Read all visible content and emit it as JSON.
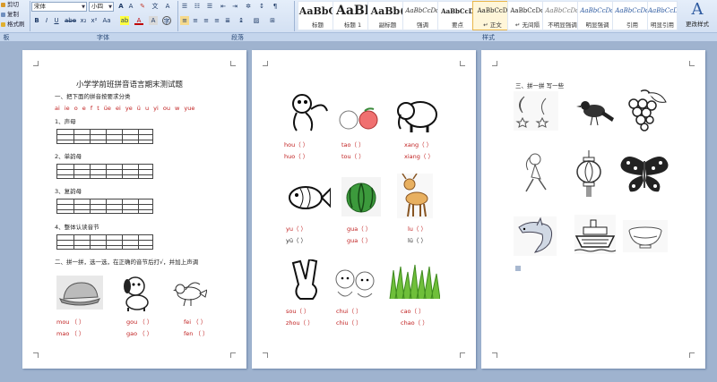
{
  "ribbon": {
    "clipboard": {
      "cut": "剪切",
      "copy": "复制",
      "format_painter": "格式刷"
    },
    "font_name": "宋体",
    "font_size": "小四",
    "groups": {
      "clipboard": "板",
      "font": "字体",
      "paragraph": "段落",
      "styles": "样式"
    },
    "styles": [
      {
        "sample": "AaBbC",
        "name": "标题"
      },
      {
        "sample": "AaBl",
        "name": "标题 1"
      },
      {
        "sample": "AaBb(",
        "name": "副标题"
      },
      {
        "sample": "AaBbCcDd",
        "name": "强调"
      },
      {
        "sample": "AaBbCcD",
        "name": "要点"
      },
      {
        "sample": "AaBbCcD",
        "name": "↵ 正文"
      },
      {
        "sample": "AaBbCcDd",
        "name": "↵ 无间隔"
      },
      {
        "sample": "AaBbCcDd",
        "name": "不明显强调"
      },
      {
        "sample": "AaBbCcDd",
        "name": "明显强调"
      },
      {
        "sample": "AaBbCcDd",
        "name": "引用"
      },
      {
        "sample": "AaBbCcDd",
        "name": "明显引用"
      }
    ],
    "change_styles": "更改样式",
    "change_styles_icon": "A"
  },
  "page1": {
    "title": "小学学前班拼音语言期末测试题",
    "q1": "一、把下面的拼音按要求分类",
    "letters": "ai ie o e f t üe ei ye ü u yi ou w yue",
    "s1": "1、声母",
    "s2": "2、单韵母",
    "s3": "3、复韵母",
    "s4": "4、整体认读音节",
    "q2": "二、拼一拼，选一选，在正确的音节后打√，并加上声调",
    "w1a": "mou （  ）",
    "w1b": "mao （  ）",
    "w2a": "gou （  ）",
    "w2b": "gao （  ）",
    "w3a": "fei （  ）",
    "w3b": "fen （  ）"
  },
  "page2": {
    "r1": [
      [
        "hou（  ）",
        "huo（  ）"
      ],
      [
        "tao（  ）",
        "tou（  ）"
      ],
      [
        "xang（  ）",
        "xiang（  ）"
      ]
    ],
    "r2": [
      [
        "yu（  ）",
        "yü（  ）"
      ],
      [
        "gua（  ）",
        "gua（  ）"
      ],
      [
        "lu（  ）",
        "lü（  ）"
      ]
    ],
    "r3": [
      [
        "sou（  ）",
        "zhou（  ）"
      ],
      [
        "chui（  ）",
        "chiu（  ）"
      ],
      [
        "cao（  ）",
        "chao（  ）"
      ]
    ]
  },
  "page3": {
    "heading": "三、拼一拼  写一些"
  }
}
